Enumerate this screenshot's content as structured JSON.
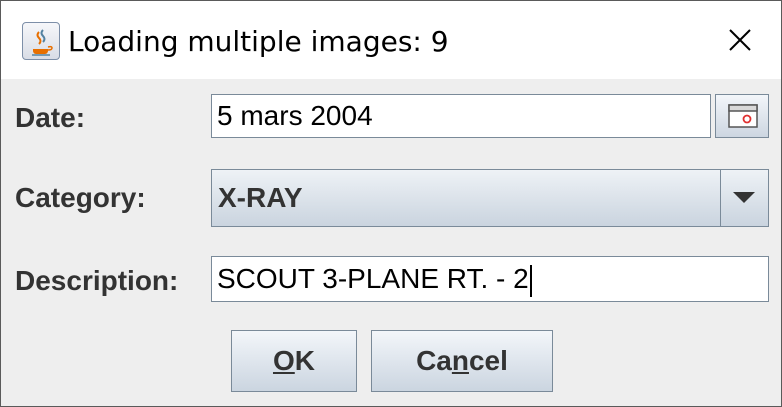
{
  "window": {
    "title": "Loading multiple images: 9",
    "icon": "java-coffee-cup-icon",
    "close_icon": "close-icon"
  },
  "form": {
    "date": {
      "label": "Date:",
      "value": "5 mars 2004",
      "button_icon": "calendar-icon"
    },
    "category": {
      "label": "Category:",
      "selected": "X-RAY",
      "arrow_icon": "chevron-down-icon"
    },
    "description": {
      "label": "Description:",
      "value": "SCOUT 3-PLANE RT. - 2"
    }
  },
  "buttons": {
    "ok": {
      "label_mnemonic": "O",
      "label_rest": "K"
    },
    "cancel": {
      "label_pre": "Ca",
      "label_mnemonic": "n",
      "label_post": "cel"
    }
  },
  "colors": {
    "dialog_bg": "#eeeeee",
    "titlebar_bg": "#ffffff",
    "border": "#7a8a99",
    "label_text": "#333333"
  }
}
